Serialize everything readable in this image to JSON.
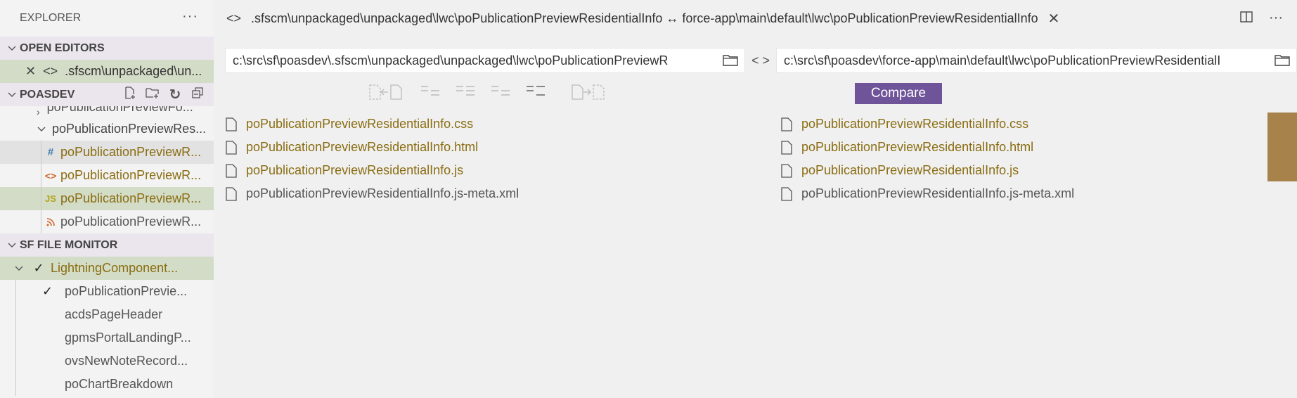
{
  "sidebar": {
    "title": "EXPLORER",
    "more": "···",
    "open_editors": {
      "label": "OPEN EDITORS",
      "items": [
        ".sfscm\\unpackaged\\un..."
      ]
    },
    "poasdev": {
      "label": "POASDEV",
      "partial_item": "poPublicationPreviewFo...",
      "folder": "poPublicationPreviewRes...",
      "files": [
        {
          "icon": "#",
          "name": "poPublicationPreviewR...",
          "icon_color": "#3d7aad"
        },
        {
          "icon": "<>",
          "name": "poPublicationPreviewR...",
          "icon_color": "#d0682a"
        },
        {
          "icon": "JS",
          "name": "poPublicationPreviewR...",
          "icon_color": "#b5a41c"
        },
        {
          "icon": "rss",
          "name": "poPublicationPreviewR...",
          "icon_color": "#d0682a"
        }
      ]
    },
    "monitor": {
      "label": "SF FILE MONITOR",
      "group": "LightningComponent...",
      "items": [
        {
          "check": "✓",
          "name": "poPublicationPrevie..."
        },
        {
          "check": "",
          "name": "acdsPageHeader"
        },
        {
          "check": "",
          "name": "gpmsPortalLandingP..."
        },
        {
          "check": "",
          "name": "ovsNewNoteRecord..."
        },
        {
          "check": "",
          "name": "poChartBreakdown"
        }
      ]
    }
  },
  "tab": {
    "title": ".sfscm\\unpackaged\\unpackaged\\lwc\\poPublicationPreviewResidentialInfo ↔ force-app\\main\\default\\lwc\\poPublicationPreviewResidentialInfo"
  },
  "compare": {
    "left_path": "c:\\src\\sf\\poasdev\\.sfscm\\unpackaged\\unpackaged\\lwc\\poPublicationPreviewR",
    "right_path": "c:\\src\\sf\\poasdev\\force-app\\main\\default\\lwc\\poPublicationPreviewResidentialI",
    "swap": "< >",
    "button": "Compare"
  },
  "left_files": [
    {
      "name": "poPublicationPreviewResidentialInfo.css",
      "changed": true
    },
    {
      "name": "poPublicationPreviewResidentialInfo.html",
      "changed": true
    },
    {
      "name": "poPublicationPreviewResidentialInfo.js",
      "changed": true
    },
    {
      "name": "poPublicationPreviewResidentialInfo.js-meta.xml",
      "changed": false
    }
  ],
  "right_files": [
    {
      "name": "poPublicationPreviewResidentialInfo.css",
      "changed": true
    },
    {
      "name": "poPublicationPreviewResidentialInfo.html",
      "changed": true
    },
    {
      "name": "poPublicationPreviewResidentialInfo.js",
      "changed": true
    },
    {
      "name": "poPublicationPreviewResidentialInfo.js-meta.xml",
      "changed": false
    }
  ],
  "colors": {
    "accent": "#6f5499",
    "changed_file": "#8a6d12",
    "scroll_marker": "#a7834b"
  }
}
